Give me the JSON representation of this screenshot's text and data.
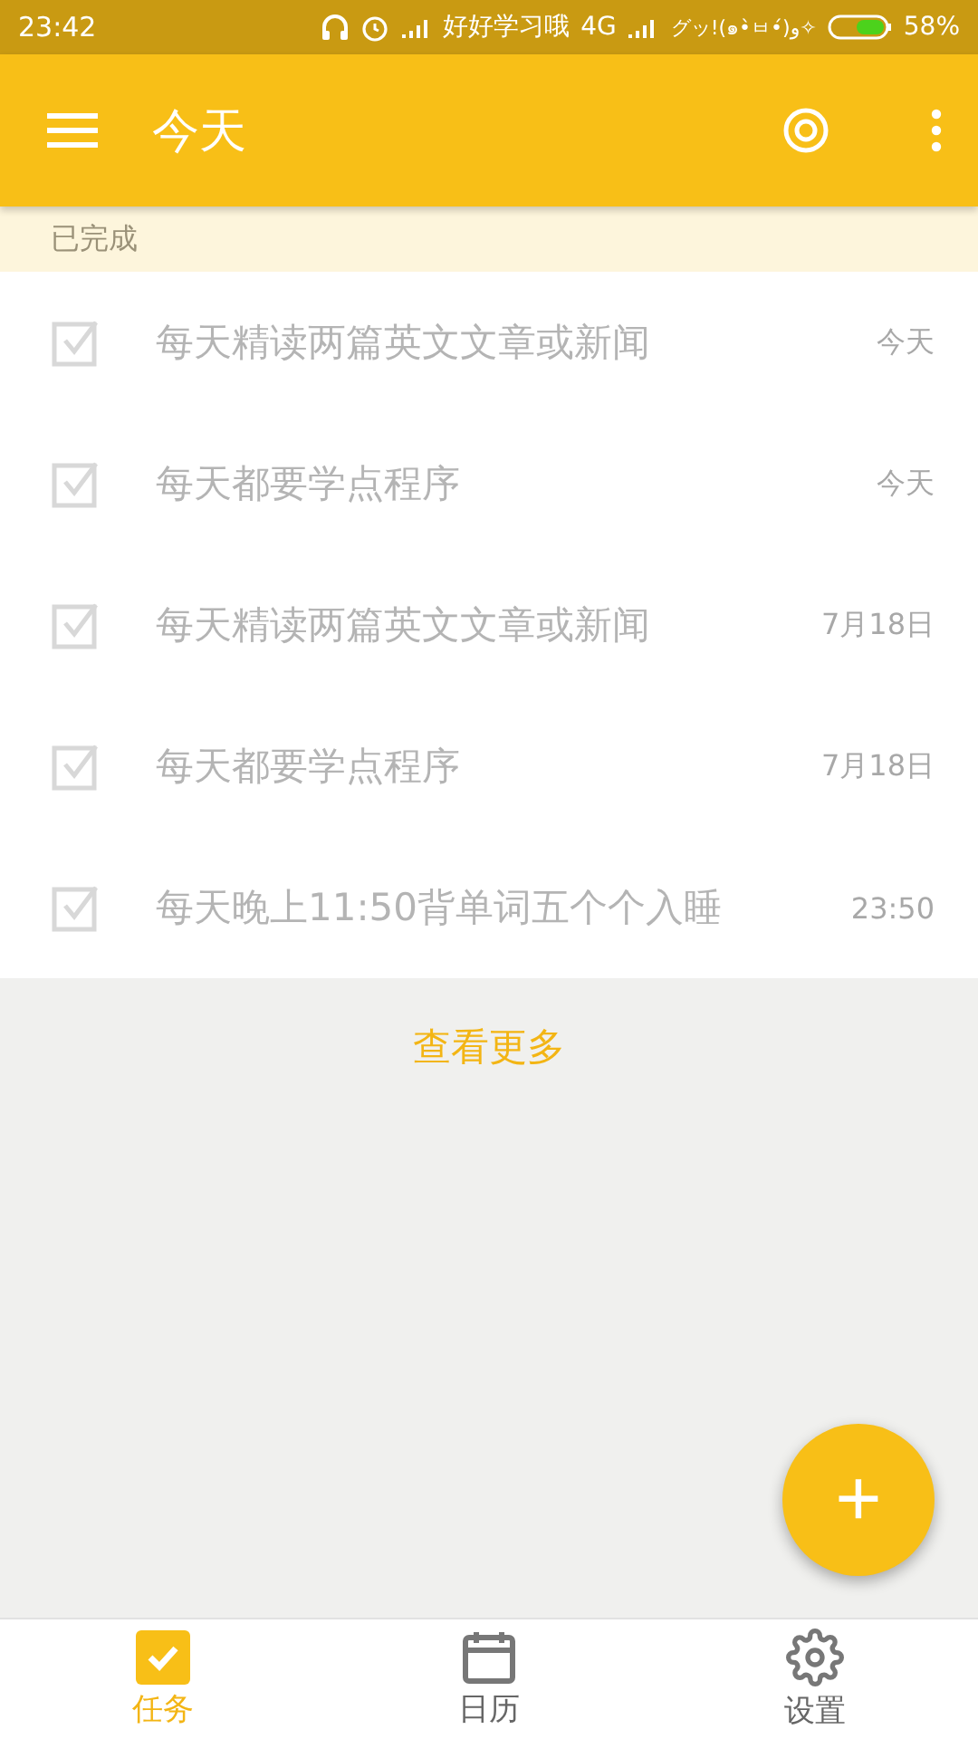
{
  "status_bar": {
    "time": "23:42",
    "carrier_1": "好好学习哦",
    "network": "4G",
    "carrier_2": "グッ!(๑•̀ㅂ•́)و✧",
    "battery": "58%"
  },
  "app_bar": {
    "title": "今天"
  },
  "section": {
    "title": "已完成"
  },
  "tasks": [
    {
      "checked": true,
      "text": "每天精读两篇英文文章或新闻",
      "date": "今天"
    },
    {
      "checked": true,
      "text": "每天都要学点程序",
      "date": "今天"
    },
    {
      "checked": true,
      "text": "每天精读两篇英文文章或新闻",
      "date": "7月18日"
    },
    {
      "checked": true,
      "text": "每天都要学点程序",
      "date": "7月18日"
    },
    {
      "checked": true,
      "text": "每天晚上11:50背单词五个个入睡",
      "date": "23:50"
    }
  ],
  "more_link": "查看更多",
  "fab": {
    "label": "+"
  },
  "bottom_nav": [
    {
      "kind": "tasks",
      "label": "任务",
      "selected": true
    },
    {
      "kind": "calendar",
      "label": "日历",
      "selected": false
    },
    {
      "kind": "settings",
      "label": "设置",
      "selected": false
    }
  ]
}
